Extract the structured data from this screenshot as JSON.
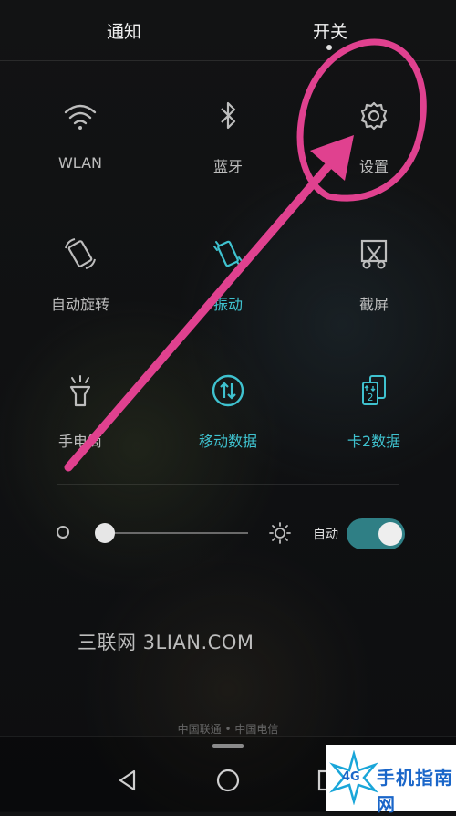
{
  "header": {
    "tab_notifications": "通知",
    "tab_toggles": "开关"
  },
  "tiles": [
    {
      "label": "WLAN",
      "icon": "wifi-icon",
      "active": false
    },
    {
      "label": "蓝牙",
      "icon": "bluetooth-icon",
      "active": false
    },
    {
      "label": "设置",
      "icon": "gear-icon",
      "active": false
    },
    {
      "label": "自动旋转",
      "icon": "auto-rotate-icon",
      "active": false
    },
    {
      "label": "振动",
      "icon": "vibrate-icon",
      "active": true
    },
    {
      "label": "截屏",
      "icon": "screenshot-icon",
      "active": false
    },
    {
      "label": "手电筒",
      "icon": "flashlight-icon",
      "active": false
    },
    {
      "label": "移动数据",
      "icon": "mobile-data-icon",
      "active": true
    },
    {
      "label": "卡2数据",
      "icon": "sim2-data-icon",
      "active": false
    }
  ],
  "brightness": {
    "auto_label": "自动",
    "auto_on": true,
    "level": 0.0
  },
  "watermark": "三联网 3LIAN.COM",
  "carrier": "中国联通 • 中国电信",
  "logo": {
    "badge": "4G",
    "text": "手机指南网"
  },
  "colors": {
    "accent": "#3fc2cf",
    "toggle_track": "#2f7f85",
    "annotation": "#e0418f"
  }
}
